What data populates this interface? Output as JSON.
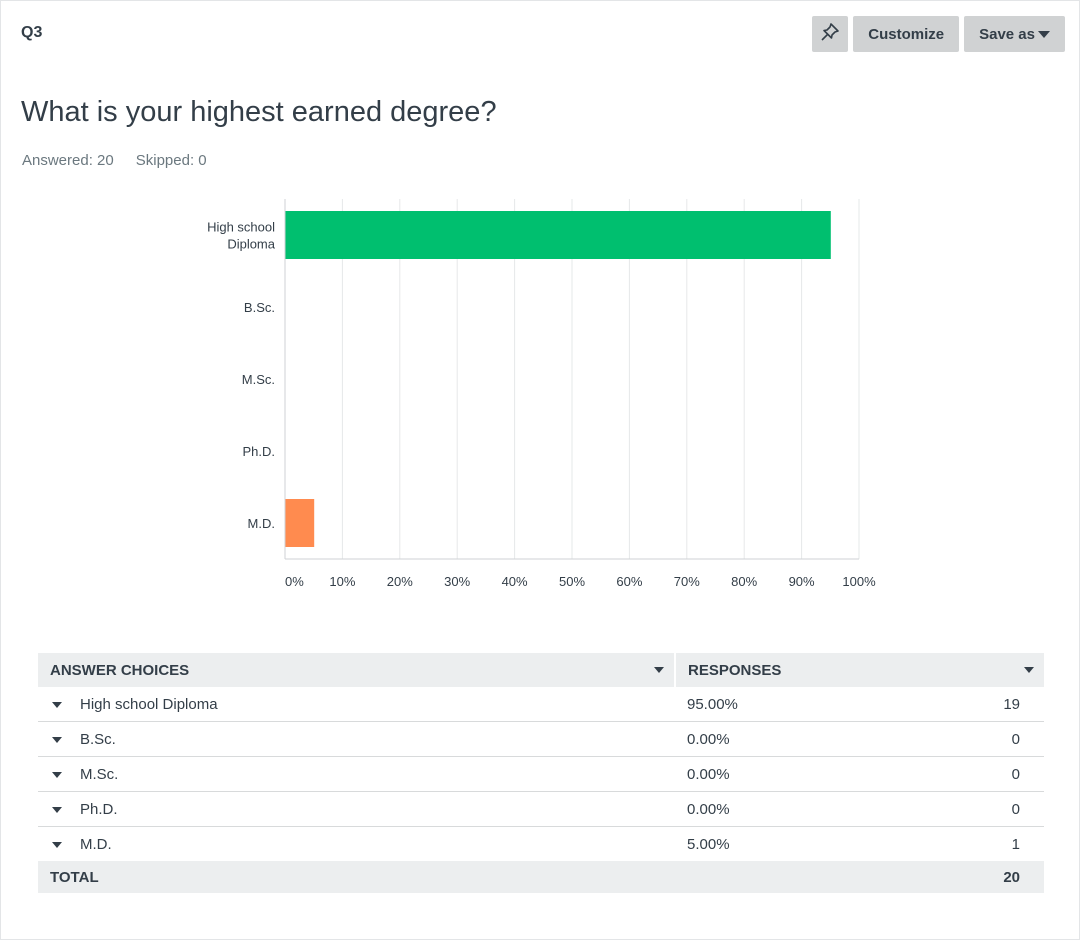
{
  "question": {
    "number": "Q3",
    "title": "What is your highest earned degree?",
    "answered": "Answered: 20",
    "skipped": "Skipped: 0"
  },
  "toolbar": {
    "pin_icon": "pushpin-icon",
    "customize_label": "Customize",
    "save_as_label": "Save as"
  },
  "chart_data": {
    "type": "bar",
    "orientation": "horizontal",
    "categories": [
      "High school Diploma",
      "B.Sc.",
      "M.Sc.",
      "Ph.D.",
      "M.D."
    ],
    "category_lines": [
      [
        "High school",
        "Diploma"
      ],
      [
        "B.Sc."
      ],
      [
        "M.Sc."
      ],
      [
        "Ph.D."
      ],
      [
        "M.D."
      ]
    ],
    "values": [
      95,
      0,
      0,
      0,
      5
    ],
    "colors": [
      "#00bf6f",
      "#507cb6",
      "#f9be00",
      "#6bc8cd",
      "#ff8b4f"
    ],
    "xlim": [
      0,
      100
    ],
    "xticks": [
      "0%",
      "10%",
      "20%",
      "30%",
      "40%",
      "50%",
      "60%",
      "70%",
      "80%",
      "90%",
      "100%"
    ],
    "grid": true
  },
  "table": {
    "headers": {
      "choices": "ANSWER CHOICES",
      "responses": "RESPONSES"
    },
    "rows": [
      {
        "choice": "High school Diploma",
        "percent": "95.00%",
        "count": "19"
      },
      {
        "choice": "B.Sc.",
        "percent": "0.00%",
        "count": "0"
      },
      {
        "choice": "M.Sc.",
        "percent": "0.00%",
        "count": "0"
      },
      {
        "choice": "Ph.D.",
        "percent": "0.00%",
        "count": "0"
      },
      {
        "choice": "M.D.",
        "percent": "5.00%",
        "count": "1"
      }
    ],
    "total_label": "TOTAL",
    "total_count": "20"
  }
}
